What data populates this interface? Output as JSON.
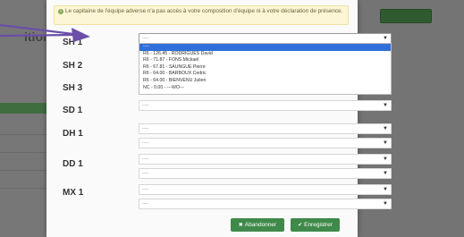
{
  "background": {
    "page_heading": "ition"
  },
  "modal": {
    "alert_text": "Le capitaine de l'équipe adverse n'a pas accès à votre composition d'équipe ni à votre déclaration de présence.",
    "rows": [
      {
        "label": "SH 1",
        "value": "----"
      },
      {
        "label": "SH 2",
        "value": "----"
      },
      {
        "label": "SH 3",
        "value": "----"
      },
      {
        "label": "SD 1",
        "value": "----"
      },
      {
        "label": "DH 1",
        "value": "----",
        "value2": "----"
      },
      {
        "label": "DD 1",
        "value": "----",
        "value2": "----"
      },
      {
        "label": "MX 1",
        "value": "----",
        "value2": "----"
      }
    ],
    "dropdown_options": [
      "----",
      "R6 - 126.45 - RODRIGUES David",
      "R6 - 71.87 - FONS Mickael",
      "R6 - 67.81 - SAUNGUE Pierre",
      "R6 - 64.00 - BARBOUX Cedric",
      "R6 - 64.00 - BIENVENU Julien",
      "NC - 0.00 - ---WO---"
    ],
    "cancel_label": "Abandonner",
    "save_label": "Enregistrer"
  },
  "colors": {
    "accent_green": "#3f8a4a",
    "selected_option": "#2f6fd9",
    "annotation_arrow": "#6b4fa8"
  }
}
